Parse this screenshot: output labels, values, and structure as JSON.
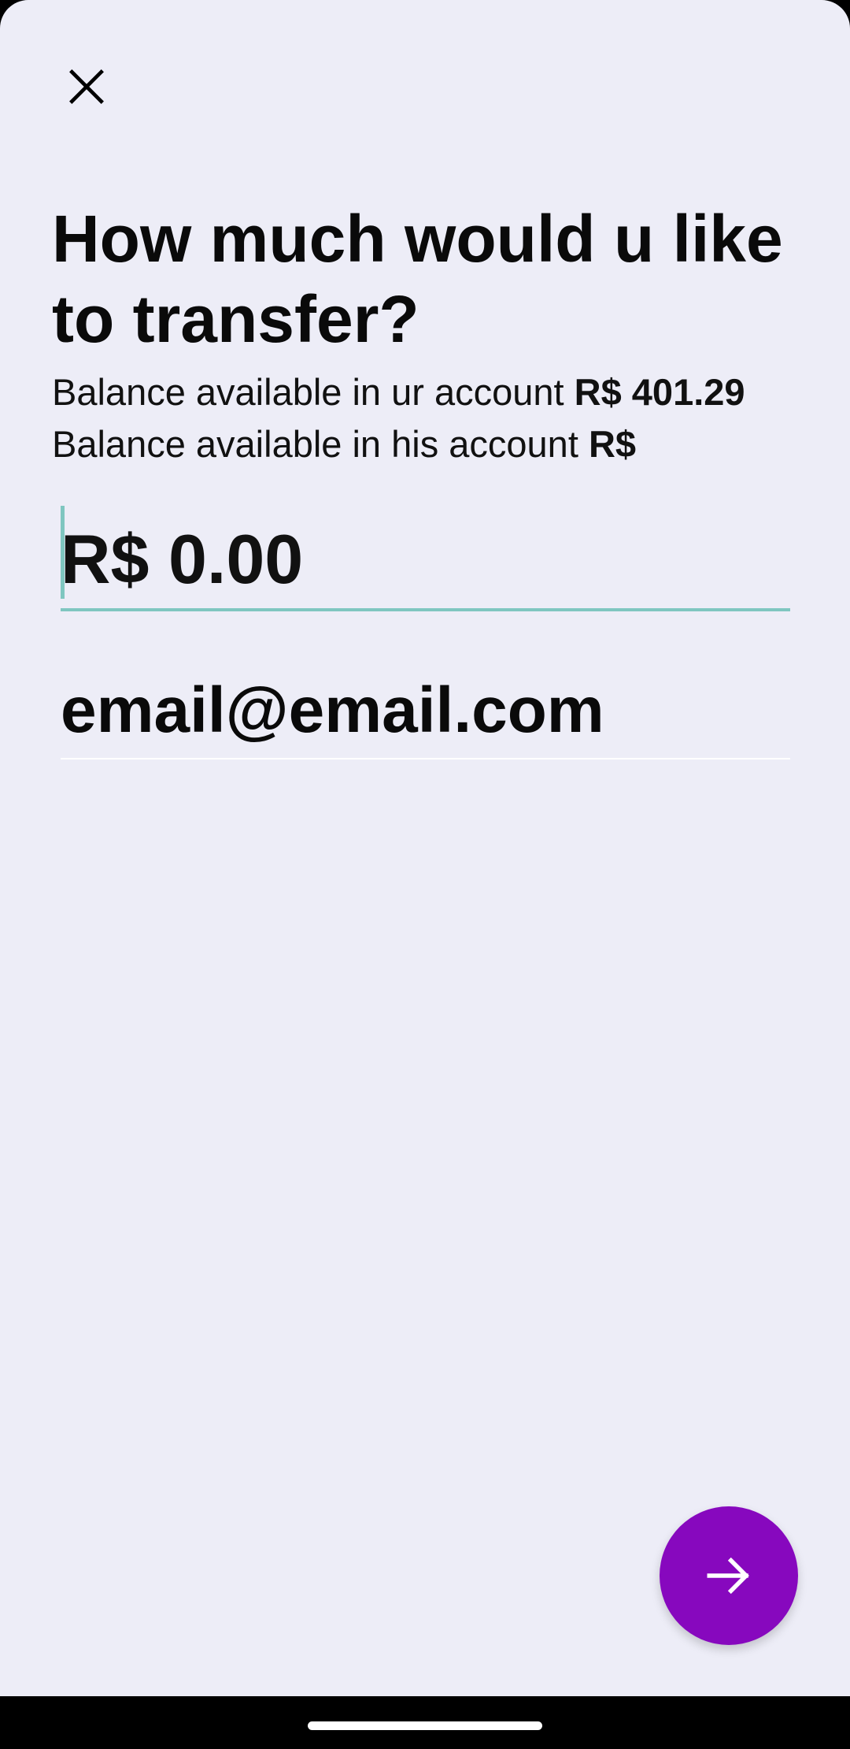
{
  "header": {
    "close_icon": "close-icon"
  },
  "title": "How much would u like to transfer?",
  "balance": {
    "mine_label": "Balance available in ur account",
    "mine_value": "R$ 401.29",
    "his_label": "Balance available in his account",
    "his_value": "R$"
  },
  "form": {
    "amount_value": "R$ 0.00",
    "email_value": "email@email.com"
  },
  "fab": {
    "icon": "arrow-right-icon"
  },
  "colors": {
    "background": "#ededf7",
    "accent": "#8708be",
    "field_underline_focused": "#7fc6c0"
  }
}
